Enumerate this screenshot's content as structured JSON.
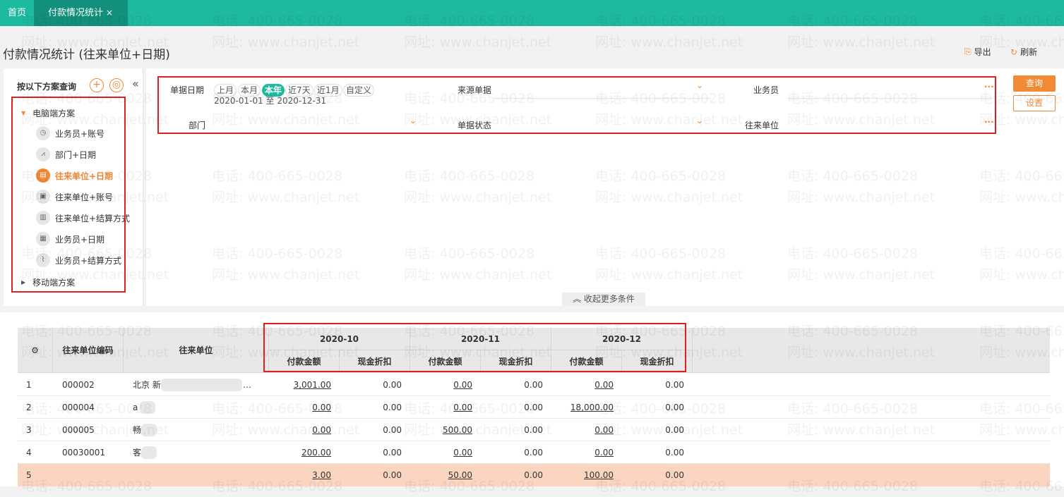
{
  "tabs": [
    {
      "label": "首页"
    },
    {
      "label": "付款情况统计",
      "close": "×"
    }
  ],
  "header": {
    "title": "付款情况统计 (往来单位+日期)",
    "export_label": "导出",
    "refresh_label": "刷新"
  },
  "sidebar": {
    "heading": "按以下方案查询",
    "add_icon": "+",
    "settings_icon": "◎",
    "collapse_icon": "«",
    "group_pc": "电脑端方案",
    "group_mobile": "移动端方案",
    "plans": [
      {
        "label": "业务员+账号",
        "icon": "clock-icon"
      },
      {
        "label": "部门+日期",
        "icon": "chart-icon"
      },
      {
        "label": "往来单位+日期",
        "icon": "table-icon",
        "selected": true
      },
      {
        "label": "往来单位+账号",
        "icon": "image-icon"
      },
      {
        "label": "往来单位+结算方式",
        "icon": "bar-icon"
      },
      {
        "label": "业务员+日期",
        "icon": "layout-icon"
      },
      {
        "label": "业务员+结算方式",
        "icon": "line-icon"
      }
    ]
  },
  "filter": {
    "date_label": "单据日期",
    "chips": [
      "上月",
      "本月",
      "本年",
      "近7天",
      "近1月",
      "自定义"
    ],
    "active_chip": "本年",
    "date_range": "2020-01-01 至 2020-12-31",
    "source_label": "来源单据",
    "salesman_label": "业务员",
    "dept_label": "部门",
    "status_label": "单据状态",
    "partner_label": "往来单位",
    "query_button": "查询",
    "settings_button": "设置",
    "more_toggle": "收起更多条件"
  },
  "table": {
    "col_code": "往来单位编码",
    "col_name": "往来单位",
    "months": [
      "2020-10",
      "2020-11",
      "2020-12"
    ],
    "sub_pay": "付款金额",
    "sub_cash": "现金折扣",
    "rows": [
      {
        "no": "1",
        "code": "000002",
        "name": "北京 新",
        "tail": "…",
        "v": [
          "3,001.00",
          "0.00",
          "0.00",
          "0.00",
          "0.00",
          "0.00"
        ]
      },
      {
        "no": "2",
        "code": "000004",
        "name": "a",
        "tail": "",
        "v": [
          "0.00",
          "0.00",
          "0.00",
          "0.00",
          "18,000.00",
          "0.00"
        ]
      },
      {
        "no": "3",
        "code": "000005",
        "name": "畅",
        "tail": "",
        "v": [
          "0.00",
          "0.00",
          "500.00",
          "0.00",
          "0.00",
          "0.00"
        ]
      },
      {
        "no": "4",
        "code": "00030001",
        "name": "客",
        "tail": "",
        "v": [
          "200.00",
          "0.00",
          "0.00",
          "0.00",
          "0.00",
          "0.00"
        ]
      }
    ],
    "total": {
      "no": "5",
      "v": [
        "3.00",
        "0.00",
        "50.00",
        "0.00",
        "100.00",
        "0.00"
      ]
    }
  },
  "watermark": {
    "phone": "电话: 400-665-0028",
    "site": "网址: www.chanjet.net"
  },
  "colors": {
    "teal": "#1dbaa0",
    "orange": "#f08a37",
    "highlight": "#e02020",
    "total_row": "#fcd5c0"
  }
}
